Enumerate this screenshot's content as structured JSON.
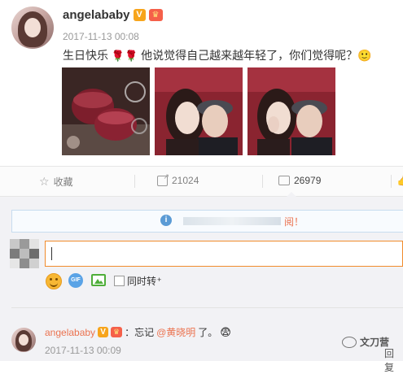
{
  "post": {
    "username": "angelababy",
    "vip_badge": "V",
    "crown_badge": "♛",
    "timestamp": "2017-11-13 00:08",
    "text_part1": "生日快乐",
    "text_part2": "他说觉得自己越来越年轻了，你们觉得呢？",
    "emoji_rose": "🌹",
    "emoji_smile": "🙂"
  },
  "actions": {
    "favorite_label": "收藏",
    "repost_count": "21024",
    "comment_count": "26979"
  },
  "comment_box": {
    "notice_text": "阅！",
    "input_value": "",
    "repost_checkbox_label": "同时转",
    "gif_label": "GIF"
  },
  "reply": {
    "username": "angelababy",
    "vip_badge": "V",
    "crown_badge": "♛",
    "prefix": "：忘记",
    "mention": "@黄晓明",
    "suffix": "了。",
    "emoji": "😨",
    "timestamp": "2017-11-13 00:09",
    "reply_label": "回复"
  },
  "watermark": {
    "text": "文刀营"
  },
  "colors": {
    "accent_orange": "#eb7350",
    "input_border": "#f18b2c",
    "notice_border": "#c7dcef"
  }
}
